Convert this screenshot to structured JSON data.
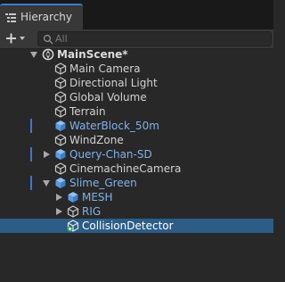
{
  "tab": {
    "title": "Hierarchy",
    "icon": "hierarchy-list-icon"
  },
  "toolbar": {
    "add_icon": "plus-dropdown-icon",
    "search_placeholder": "All",
    "search_icon": "search-icon"
  },
  "colors": {
    "selection": "#2c5d87",
    "prefab_text": "#7fb2ea",
    "accent": "#3b78d6",
    "panel": "#282828"
  },
  "tree": [
    {
      "label": "MainScene*",
      "kind": "scene",
      "expanded": true
    },
    {
      "label": "Main Camera",
      "kind": "gameobject"
    },
    {
      "label": "Directional Light",
      "kind": "gameobject"
    },
    {
      "label": "Global Volume",
      "kind": "gameobject"
    },
    {
      "label": "Terrain",
      "kind": "gameobject"
    },
    {
      "label": "WaterBlock_50m",
      "kind": "prefab",
      "modified": true
    },
    {
      "label": "WindZone",
      "kind": "gameobject"
    },
    {
      "label": "Query-Chan-SD",
      "kind": "prefab",
      "expanded": false,
      "modified": true
    },
    {
      "label": "CinemachineCamera",
      "kind": "gameobject"
    },
    {
      "label": "Slime_Green",
      "kind": "prefab",
      "expanded": true,
      "modified": true
    },
    {
      "label": "MESH",
      "kind": "prefab",
      "expanded": false
    },
    {
      "label": "RIG",
      "kind": "gameobject",
      "expanded": false
    },
    {
      "label": "CollisionDetector",
      "kind": "prefab-variant-added",
      "selected": true
    }
  ]
}
